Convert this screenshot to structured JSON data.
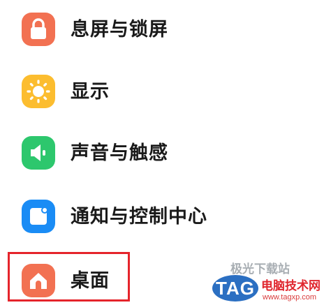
{
  "settings": {
    "items": [
      {
        "label": "息屏与锁屏",
        "icon": "lock-icon",
        "color": "#f27152"
      },
      {
        "label": "显示",
        "icon": "sun-icon",
        "color": "#fcbd2f"
      },
      {
        "label": "声音与触感",
        "icon": "speaker-icon",
        "color": "#2dc76d"
      },
      {
        "label": "通知与控制中心",
        "icon": "notification-icon",
        "color": "#1a8cf5"
      },
      {
        "label": "桌面",
        "icon": "home-icon",
        "color": "#f27152"
      }
    ],
    "highlight_color": "#e5242b"
  },
  "watermark": {
    "top_text": "极光下载站",
    "tag": "TAG",
    "site_name": "电脑技术网",
    "url": "www.tagxp.com"
  }
}
